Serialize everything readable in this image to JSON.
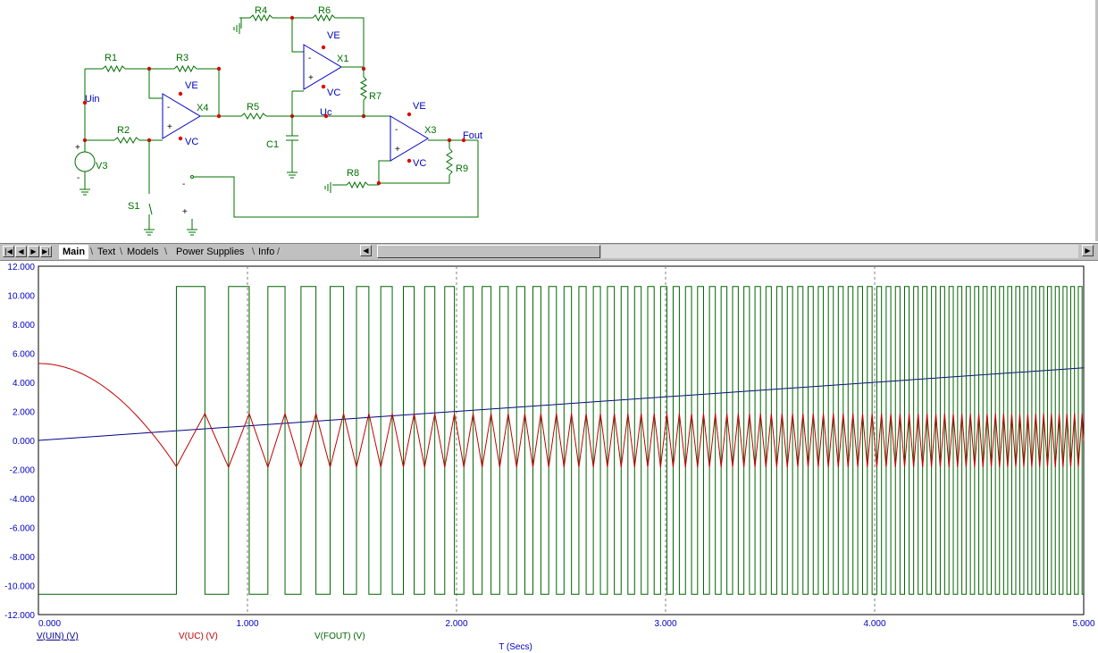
{
  "schematic": {
    "components": [
      "R1",
      "R2",
      "R3",
      "R4",
      "R5",
      "R6",
      "R7",
      "R8",
      "R9",
      "X1",
      "X3",
      "X4",
      "C1",
      "V3",
      "S1"
    ],
    "nodes": {
      "uin": "Uin",
      "uc": "Uc",
      "fout": "Fout"
    },
    "opamp_pins": {
      "ve": "VE",
      "vc": "VC"
    },
    "signs": {
      "plus": "+",
      "minus": "-"
    }
  },
  "tabs": {
    "items": [
      "Main",
      "Text",
      "Models",
      "Power Supplies",
      "Info"
    ],
    "active": "Main"
  },
  "colors": {
    "component": "#007000",
    "wire": "#007000",
    "node_label": "#0000c0",
    "junction": "#e00000",
    "trace_uin": "#00008b",
    "trace_uc": "#c00000",
    "trace_fout": "#006400",
    "axis_text": "#0000c0"
  },
  "chart_data": {
    "type": "line",
    "xlabel": "T (Secs)",
    "xlim": [
      0,
      5
    ],
    "ylim": [
      -12,
      12
    ],
    "x_ticks": [
      "0.000",
      "1.000",
      "2.000",
      "3.000",
      "4.000",
      "5.000"
    ],
    "y_ticks": [
      "12.000",
      "10.000",
      "8.000",
      "6.000",
      "4.000",
      "2.000",
      "0.000",
      "-2.000",
      "-4.000",
      "-6.000",
      "-8.000",
      "-10.000",
      "-12.000"
    ],
    "grid": "vertical dashed",
    "series": [
      {
        "name": "V(UIN) (V)",
        "description_points": [
          [
            0,
            0
          ],
          [
            5,
            5
          ]
        ]
      },
      {
        "name": "V(UC) (V)",
        "initial": 5.3,
        "first_low": -1.8,
        "band": [
          -1.85,
          1.85
        ]
      },
      {
        "name": "V(FOUT) (V)",
        "levels": [
          -10.6,
          10.6
        ],
        "first_rise": 0.66
      }
    ]
  }
}
